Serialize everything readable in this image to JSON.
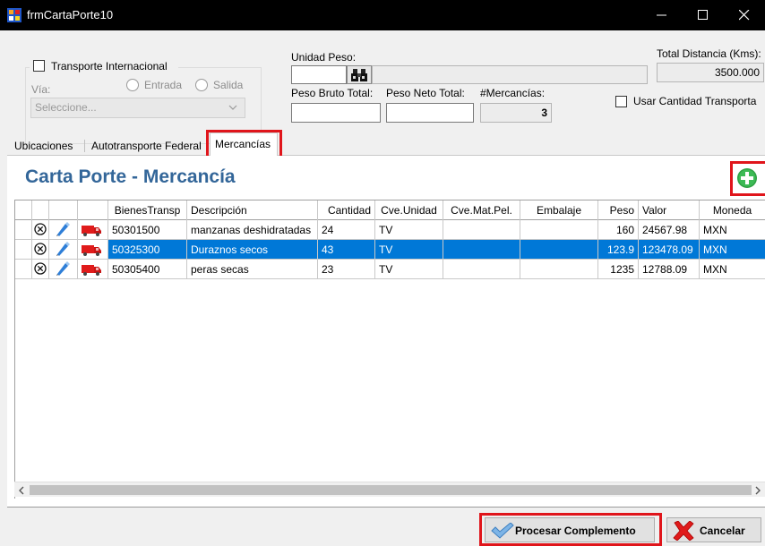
{
  "window": {
    "title": "frmCartaPorte10"
  },
  "transporte": {
    "internacional_label": "Transporte Internacional",
    "via_label": "Vía:",
    "entrada_label": "Entrada",
    "salida_label": "Salida",
    "combo_placeholder": "Seleccione..."
  },
  "peso": {
    "unidad_label": "Unidad Peso:",
    "bruto_label": "Peso Bruto Total:",
    "neto_label": "Peso Neto Total:",
    "mercancias_label": "#Mercancías:",
    "mercancias_value": "3",
    "distancia_label": "Total Distancia (Kms):",
    "distancia_value": "3500.000",
    "usar_cantidad_label": "Usar Cantidad Transporta"
  },
  "tabs": [
    {
      "label": "Ubicaciones"
    },
    {
      "label": "Autotransporte Federal"
    },
    {
      "label": "Mercancías",
      "active": true
    }
  ],
  "panel": {
    "heading": "Carta Porte - Mercancía"
  },
  "grid": {
    "columns": [
      "BienesTransp",
      "Descripción",
      "Cantidad",
      "Cve.Unidad",
      "Cve.Mat.Pel.",
      "Embalaje",
      "Peso",
      "Valor",
      "Moneda"
    ],
    "rows": [
      {
        "bienes": "50301500",
        "descripcion": "manzanas deshidratadas",
        "cantidad": "24",
        "cve_unidad": "TV",
        "cve_mat": "",
        "embalaje": "",
        "peso": "160",
        "valor": "24567.98",
        "moneda": "MXN",
        "selected": false
      },
      {
        "bienes": "50325300",
        "descripcion": "Duraznos secos",
        "cantidad": "43",
        "cve_unidad": "TV",
        "cve_mat": "",
        "embalaje": "",
        "peso": "123.9",
        "valor": "123478.09",
        "moneda": "MXN",
        "selected": true
      },
      {
        "bienes": "50305400",
        "descripcion": "peras secas",
        "cantidad": "23",
        "cve_unidad": "TV",
        "cve_mat": "",
        "embalaje": "",
        "peso": "1235",
        "valor": "12788.09",
        "moneda": "MXN",
        "selected": false
      }
    ]
  },
  "buttons": {
    "procesar_label": "Procesar Complemento",
    "cancelar_label": "Cancelar"
  },
  "colors": {
    "accent": "#336699",
    "highlight": "#e0151b",
    "selection": "#0078d7"
  }
}
